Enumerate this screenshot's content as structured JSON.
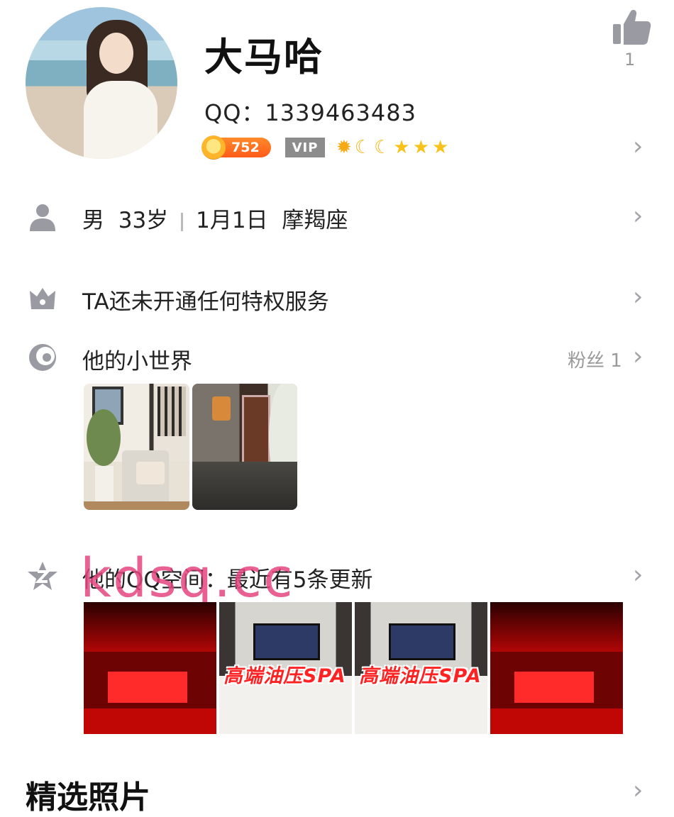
{
  "profile": {
    "nickname": "大马哈",
    "qq": "QQ：1339463483",
    "coins": "752",
    "vip": "VIP",
    "level_icons": [
      "sun-icon",
      "moon-icon",
      "moon-icon",
      "star-icon",
      "star-icon",
      "star-icon"
    ],
    "likes": "1"
  },
  "info": {
    "gender": "男",
    "age": "33岁",
    "birthday": "1月1日",
    "zodiac": "摩羯座"
  },
  "privilege": {
    "text": "TA还未开通任何特权服务"
  },
  "world": {
    "title": "他的小世界",
    "fans_label": "粉丝 1"
  },
  "qzone": {
    "title": "他的QQ空间：最近有5条更新"
  },
  "watermark": "kdsq.cc",
  "photos": {
    "spa_text": "高端油压SPA"
  },
  "featured": {
    "title": "精选照片"
  },
  "colors": {
    "accent_coin": "#ff6a1f",
    "vip_gray": "#8c8c8c",
    "icon_gray": "#9a9aa3",
    "watermark": "#e6457f"
  }
}
